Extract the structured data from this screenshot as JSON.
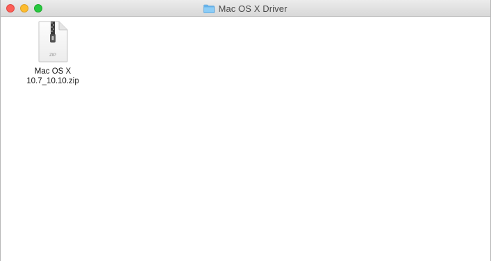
{
  "window": {
    "title": "Mac OS X Driver",
    "title_icon": "folder-icon"
  },
  "traffic_lights": {
    "close": "#fc5f57",
    "minimize": "#fdbc2e",
    "zoom": "#28c840"
  },
  "files": [
    {
      "name_line1": "Mac OS X",
      "name_line2": "10.7_10.10.zip",
      "icon": "zip-file-icon",
      "icon_label": "ZIP"
    }
  ]
}
